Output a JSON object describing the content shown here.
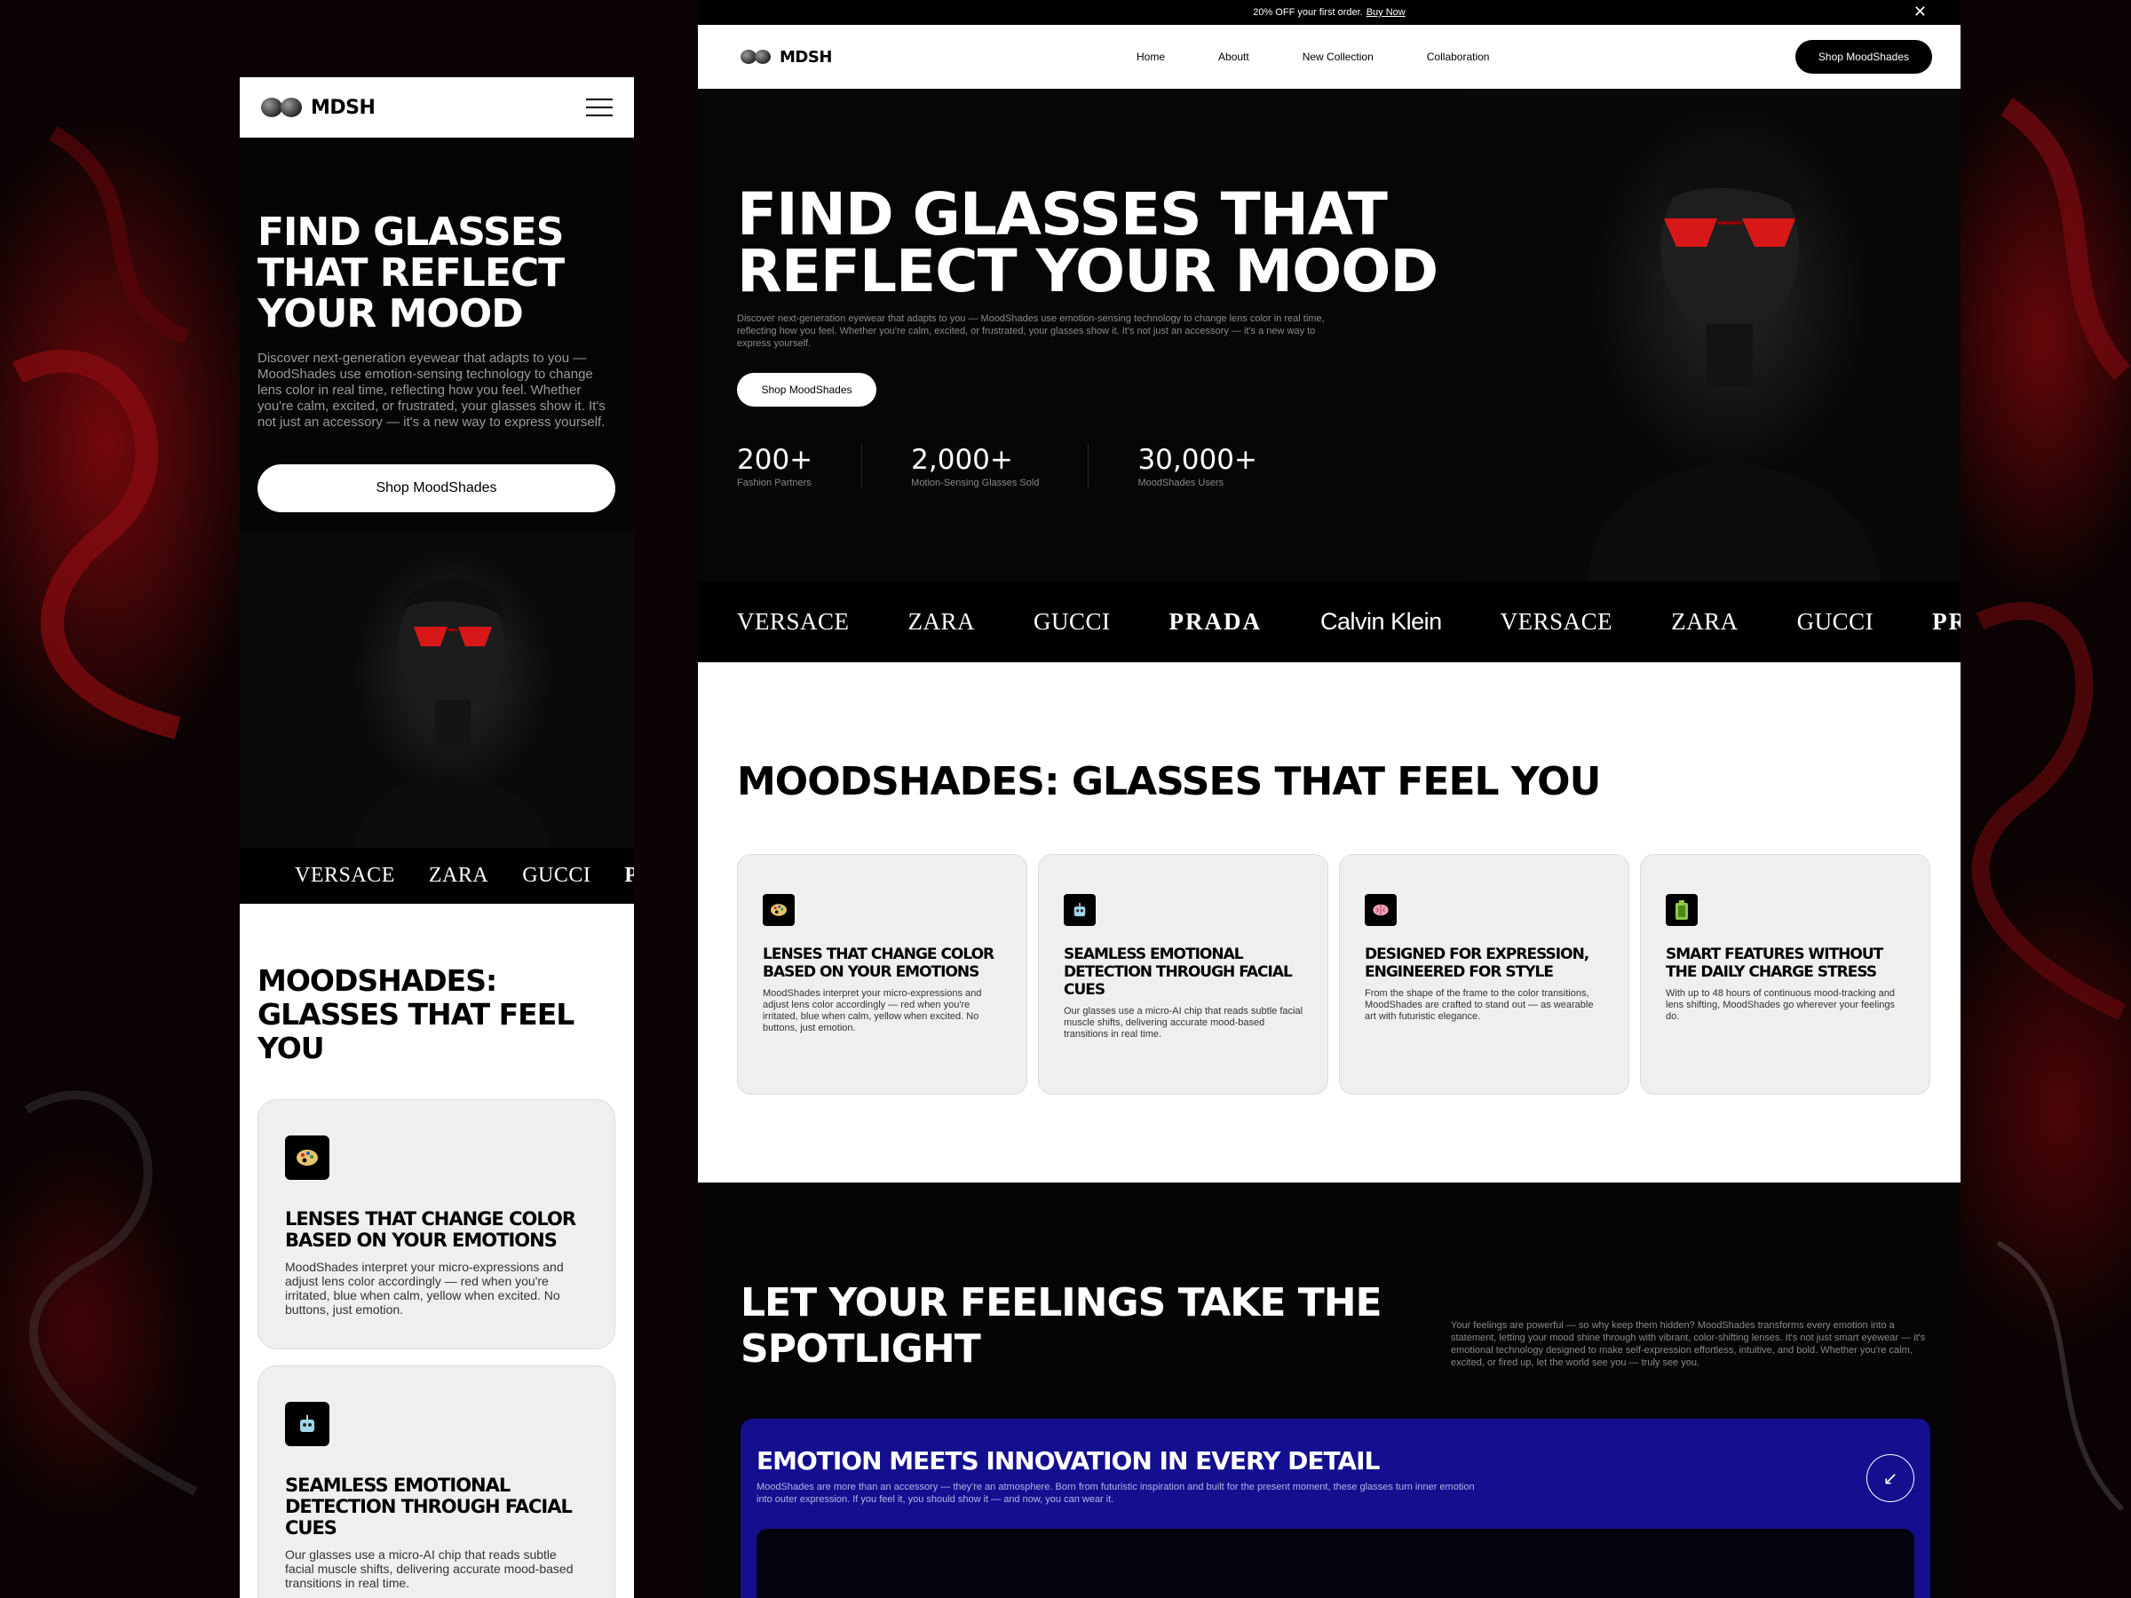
{
  "brand": {
    "logo_text": "MDSH",
    "accent_red": "#e01010",
    "blue_panel": "#140f8f"
  },
  "mobile": {
    "menu_icon": "hamburger-icon",
    "hero": {
      "title": "FIND GLASSES THAT REFLECT YOUR MOOD",
      "description": "Discover next-generation eyewear that adapts to you — MoodShades use emotion-sensing technology to change lens color in real time, reflecting how you feel. Whether you're calm, excited, or frustrated, your glasses show it. It's not just an accessory — it's a new way to express yourself.",
      "cta": "Shop MoodShades"
    },
    "brands": [
      "VERSACE",
      "ZARA",
      "GUCCI",
      "PR"
    ],
    "features": {
      "title": "MOODSHADES: GLASSES THAT FEEL YOU",
      "cards": [
        {
          "icon": "palette-icon",
          "title": "LENSES THAT CHANGE COLOR BASED ON YOUR EMOTIONS",
          "text": "MoodShades interpret your micro-expressions and adjust lens color accordingly — red when you're irritated, blue when calm, yellow when excited. No buttons, just emotion."
        },
        {
          "icon": "robot-icon",
          "title": "SEAMLESS EMOTIONAL DETECTION THROUGH FACIAL CUES",
          "text": "Our glasses use a micro-AI chip that reads subtle facial muscle shifts, delivering accurate mood-based transitions in real time."
        }
      ]
    }
  },
  "desktop": {
    "announcement": {
      "text": "20% OFF your first order.",
      "link": "Buy Now",
      "close": "✕"
    },
    "nav": {
      "links": [
        "Home",
        "Aboutt",
        "New Collection",
        "Collaboration"
      ],
      "cta": "Shop MoodShades"
    },
    "hero": {
      "title": "FIND GLASSES THAT REFLECT YOUR MOOD",
      "description": "Discover next-generation eyewear that adapts to you — MoodShades use emotion-sensing technology to change lens color in real time, reflecting how you feel. Whether you're calm, excited, or frustrated, your glasses show it. It's not just an accessory — it's a new way to express yourself.",
      "cta": "Shop MoodShades",
      "stats": [
        {
          "value": "200+",
          "label": "Fashion Partners"
        },
        {
          "value": "2,000+",
          "label": "Motion-Sensing Glasses Sold"
        },
        {
          "value": "30,000+",
          "label": "MoodShades Users"
        }
      ]
    },
    "brands": [
      "VERSACE",
      "ZARA",
      "GUCCI",
      "PRADA",
      "Calvin Klein",
      "VERSACE",
      "ZARA",
      "GUCCI",
      "PRA"
    ],
    "features": {
      "title": "MOODSHADES: GLASSES THAT FEEL YOU",
      "cards": [
        {
          "icon": "palette-icon",
          "title": "LENSES THAT CHANGE COLOR BASED ON YOUR EMOTIONS",
          "text": "MoodShades interpret your micro-expressions and adjust lens color accordingly — red when you're irritated, blue when calm, yellow when excited. No buttons, just emotion."
        },
        {
          "icon": "robot-icon",
          "title": "SEAMLESS EMOTIONAL DETECTION THROUGH FACIAL CUES",
          "text": "Our glasses use a micro-AI chip that reads subtle facial muscle shifts, delivering accurate mood-based transitions in real time."
        },
        {
          "icon": "brain-icon",
          "title": "DESIGNED FOR EXPRESSION, ENGINEERED FOR STYLE",
          "text": "From the shape of the frame to the color transitions, MoodShades are crafted to stand out — as wearable art with futuristic elegance."
        },
        {
          "icon": "battery-icon",
          "title": "SMART FEATURES WITHOUT THE DAILY CHARGE STRESS",
          "text": "With up to 48 hours of continuous mood-tracking and lens shifting, MoodShades go wherever your feelings do."
        }
      ]
    },
    "spotlight": {
      "title": "LET YOUR FEELINGS TAKE THE SPOTLIGHT",
      "text": "Your feelings are powerful — so why keep them hidden? MoodShades transforms every emotion into a statement, letting your mood shine through with vibrant, color-shifting lenses. It's not just smart eyewear — it's emotional technology designed to make self-expression effortless, intuitive, and bold. Whether you're calm, excited, or fired up, let the world see you — truly see you."
    },
    "innovation": {
      "title": "EMOTION MEETS INNOVATION IN EVERY DETAIL",
      "text": "MoodShades are more than an accessory — they're an atmosphere. Born from futuristic inspiration and built for the present moment, these glasses turn inner emotion into outer expression. If you feel it, you should show it — and now, you can wear it.",
      "arrow": "↙"
    }
  }
}
